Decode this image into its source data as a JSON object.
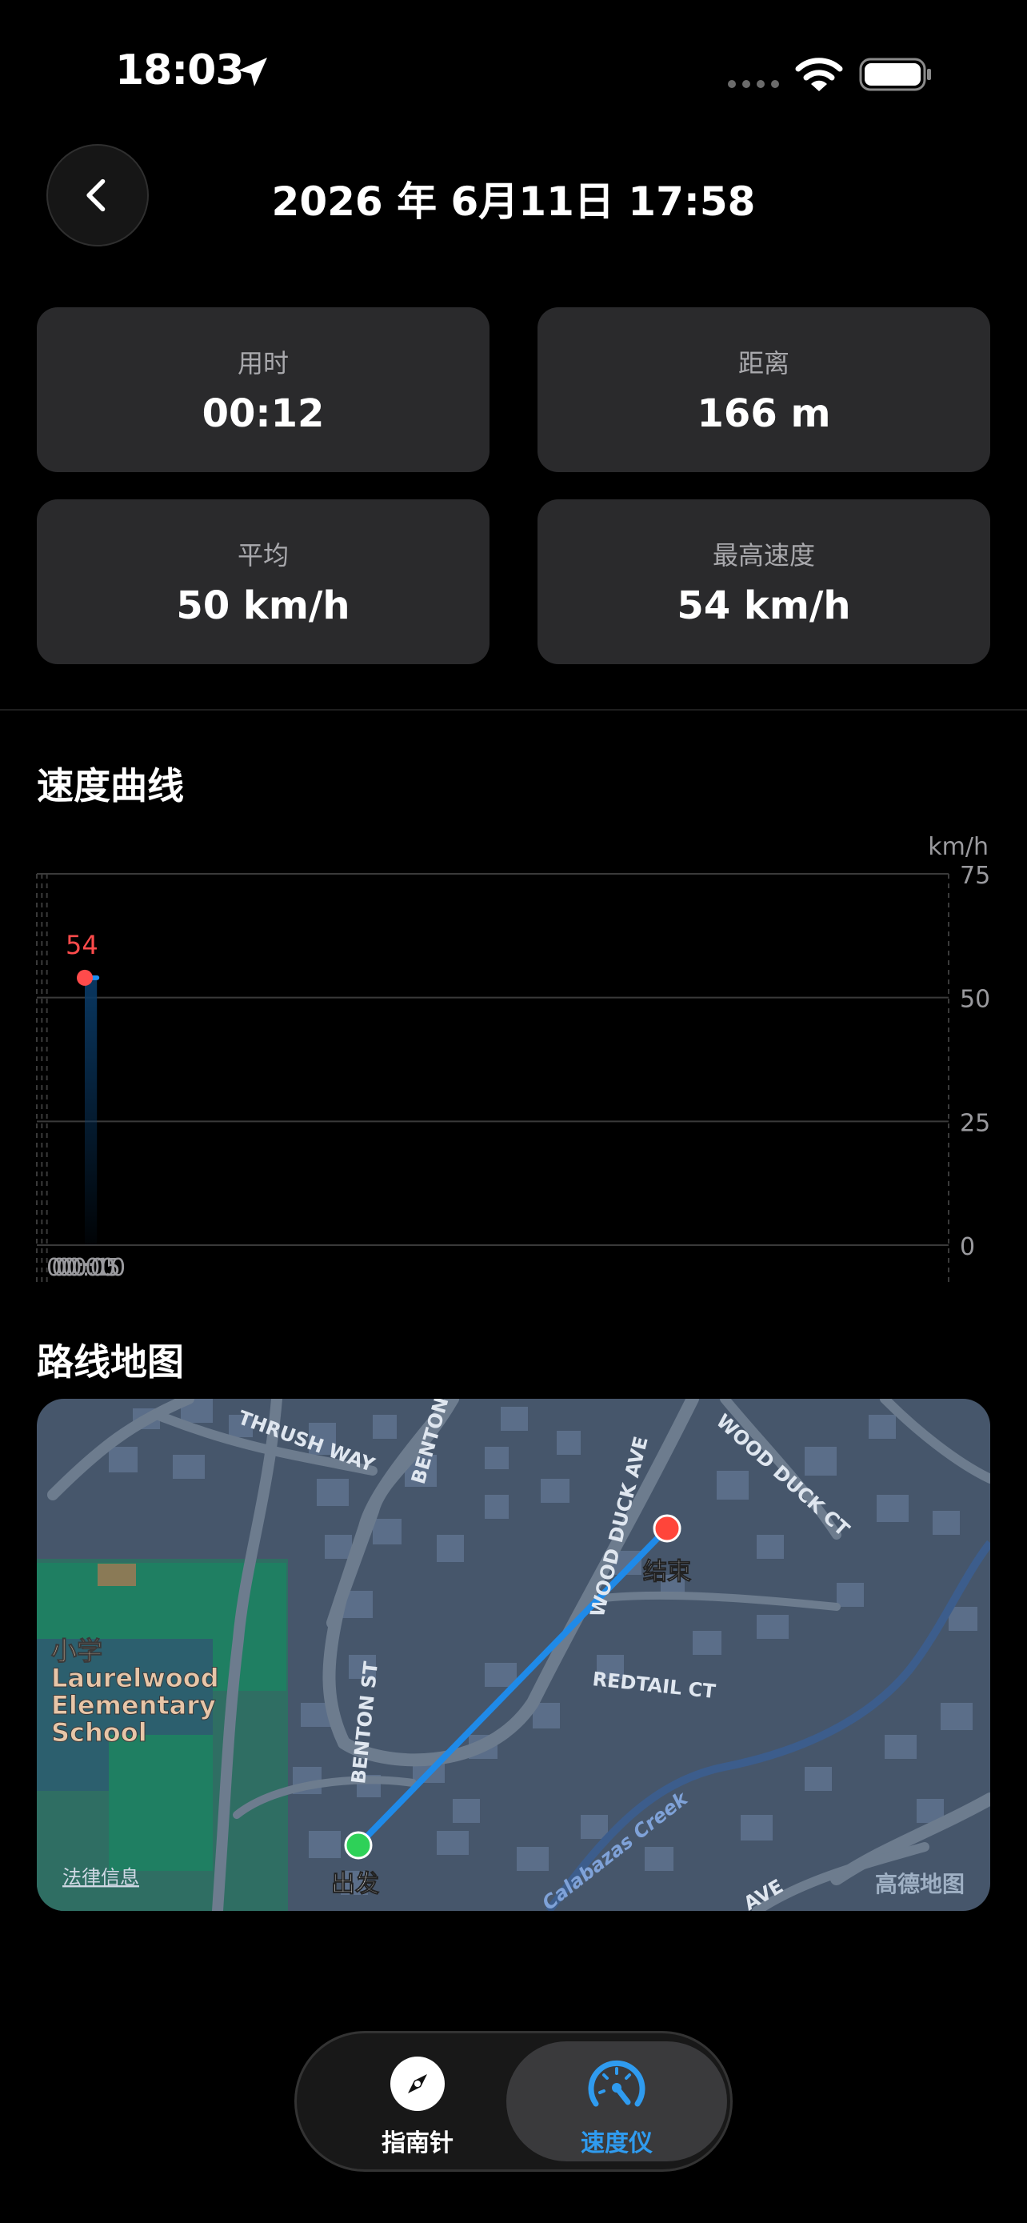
{
  "status_bar": {
    "time": "18:03"
  },
  "header": {
    "title": "2026 年 6月11日  17:58"
  },
  "stats": [
    {
      "label": "用时",
      "value": "00:12"
    },
    {
      "label": "距离",
      "value": "166 m"
    },
    {
      "label": "平均",
      "value": "50 km/h"
    },
    {
      "label": "最高速度",
      "value": "54 km/h"
    }
  ],
  "speed_section": {
    "title": "速度曲线"
  },
  "chart_data": {
    "type": "area",
    "x": [
      "00:00",
      "00:12"
    ],
    "y": [
      54,
      54
    ],
    "ylabel": "km/h",
    "ylim": [
      0,
      75
    ],
    "yticks": [
      "75",
      "50",
      "25",
      "0"
    ],
    "xticks": [
      "00:00",
      "00:05",
      "00:10"
    ],
    "xlim_minutes": [
      0,
      15
    ],
    "annotation": "54",
    "grid": true,
    "colors": {
      "line": "#1d8ef0",
      "max_point": "#ff4b4b"
    }
  },
  "map_section": {
    "title": "路线地图",
    "labels": {
      "thrush_way": "THRUSH WAY",
      "benton_st_top": "BENTON",
      "wood_duck_ave": "WOOD DUCK AVE",
      "wood_duck_ct": "WOOD DUCK CT",
      "redtail_ct": "REDTAIL CT",
      "benton_st": "BENTON ST",
      "school_cn": "小学",
      "school_1": "Laurelwood",
      "school_2": "Elementary",
      "school_3": "School",
      "creek": "Calabazas Creek",
      "ave": "AVE",
      "end": "结束",
      "start": "出发",
      "legal": "法律信息",
      "provider": "高德地图"
    },
    "colors": {
      "route": "#1f8ae8",
      "start": "#2ed158",
      "end": "#ff453a"
    }
  },
  "tabs": [
    {
      "label": "指南针",
      "icon": "compass-icon"
    },
    {
      "label": "速度仪",
      "icon": "speedometer-icon",
      "active": true
    }
  ]
}
